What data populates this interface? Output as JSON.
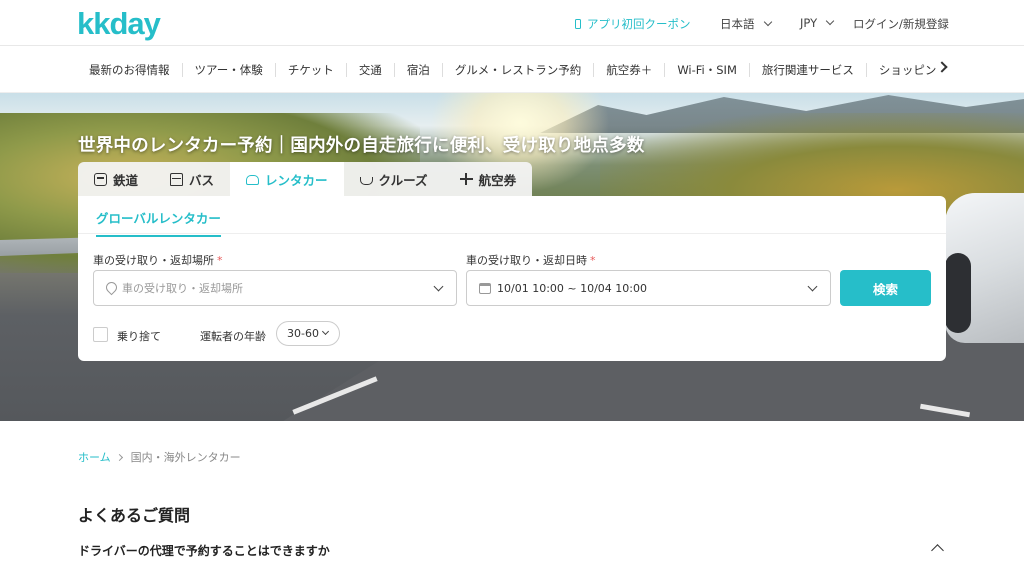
{
  "header": {
    "logo": "kkday",
    "coupon": "アプリ初回クーポン",
    "language": "日本語",
    "currency": "JPY",
    "login": "ログイン/新規登録"
  },
  "nav": {
    "items": [
      "最新のお得情報",
      "ツアー・体験",
      "チケット",
      "交通",
      "宿泊",
      "グルメ・レストラン予約",
      "航空券＋",
      "Wi-Fi・SIM",
      "旅行関連サービス",
      "ショッピン"
    ]
  },
  "hero": {
    "title": "世界中のレンタカー予約｜国内外の自走旅行に便利、受け取り地点多数"
  },
  "tabs": [
    {
      "label": "鉄道",
      "icon": "train-icon"
    },
    {
      "label": "バス",
      "icon": "bus-icon"
    },
    {
      "label": "レンタカー",
      "icon": "car-icon"
    },
    {
      "label": "クルーズ",
      "icon": "ship-icon"
    },
    {
      "label": "航空券",
      "icon": "plane-icon"
    }
  ],
  "search": {
    "subtab": "グローバルレンタカー",
    "location_label": "車の受け取り・返却場所",
    "location_placeholder": "車の受け取り・返却場所",
    "datetime_label": "車の受け取り・返却日時",
    "datetime_value": "10/01 10:00 ~ 10/04 10:00",
    "search_button": "検索",
    "oneway_label": "乗り捨て",
    "age_label": "運転者の年齢",
    "age_value": "30-60",
    "required_mark": "*"
  },
  "breadcrumb": {
    "home": "ホーム",
    "current": "国内・海外レンタカー"
  },
  "faq": {
    "title": "よくあるご質問",
    "question": "ドライバーの代理で予約することはできますか"
  },
  "colors": {
    "accent": "#26bec9",
    "required": "#e85a5a"
  }
}
